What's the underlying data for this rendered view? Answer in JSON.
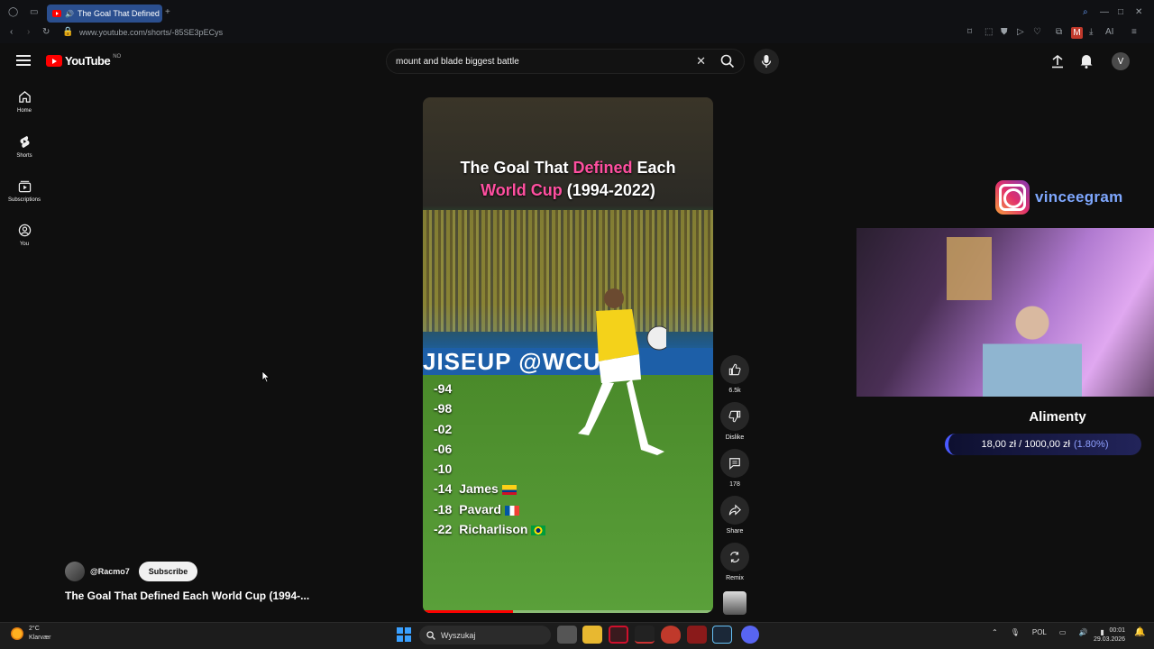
{
  "browser": {
    "tab_title": "The Goal That Defined",
    "url": "www.youtube.com/shorts/-85SE3pECys",
    "ai_label": "AI"
  },
  "header": {
    "logo_text": "YouTube",
    "country_code": "NO",
    "search_query": "mount and blade biggest battle",
    "avatar_letter": "V"
  },
  "sidebar": {
    "items": [
      {
        "label": "Home",
        "icon": "home-icon"
      },
      {
        "label": "Shorts",
        "icon": "shorts-icon"
      },
      {
        "label": "Subscriptions",
        "icon": "subscriptions-icon"
      },
      {
        "label": "You",
        "icon": "you-icon"
      }
    ]
  },
  "short": {
    "title_part1": "The Goal That ",
    "title_highlight1": "Defined",
    "title_part2": " Each",
    "title_highlight2": "World Cup",
    "title_part3": " (1994-2022)",
    "board_text": "JISEUP @WCUP",
    "years": [
      {
        "year": "-94",
        "name": ""
      },
      {
        "year": "-98",
        "name": ""
      },
      {
        "year": "-02",
        "name": ""
      },
      {
        "year": "-06",
        "name": ""
      },
      {
        "year": "-10",
        "name": ""
      },
      {
        "year": "-14",
        "name": "James",
        "flag": "colombia"
      },
      {
        "year": "-18",
        "name": "Pavard",
        "flag": "france"
      },
      {
        "year": "-22",
        "name": "Richarlison",
        "flag": "brazil"
      }
    ],
    "progress": 0.31
  },
  "actions": {
    "like_count": "6.5k",
    "dislike_label": "Dislike",
    "comment_count": "178",
    "share_label": "Share",
    "remix_label": "Remix"
  },
  "channel": {
    "handle": "@Racmo7",
    "subscribe_label": "Subscribe",
    "video_title": "The Goal That Defined Each World Cup (1994-..."
  },
  "overlay": {
    "instagram_handle": "vinceegram",
    "goal_title": "Alimenty",
    "goal_amount": "18,00 zł / 1000,00 zł",
    "goal_percent": "(1.80%)"
  },
  "taskbar": {
    "temperature": "2°C",
    "location": "Klarvær",
    "search_placeholder": "Wyszukaj",
    "language": "POL",
    "time": "00:01",
    "date": "29.03.2026"
  },
  "colors": {
    "accent_red": "#ff0000",
    "highlight_pink": "#ff4fa0",
    "goal_blue": "#4a5aff"
  }
}
